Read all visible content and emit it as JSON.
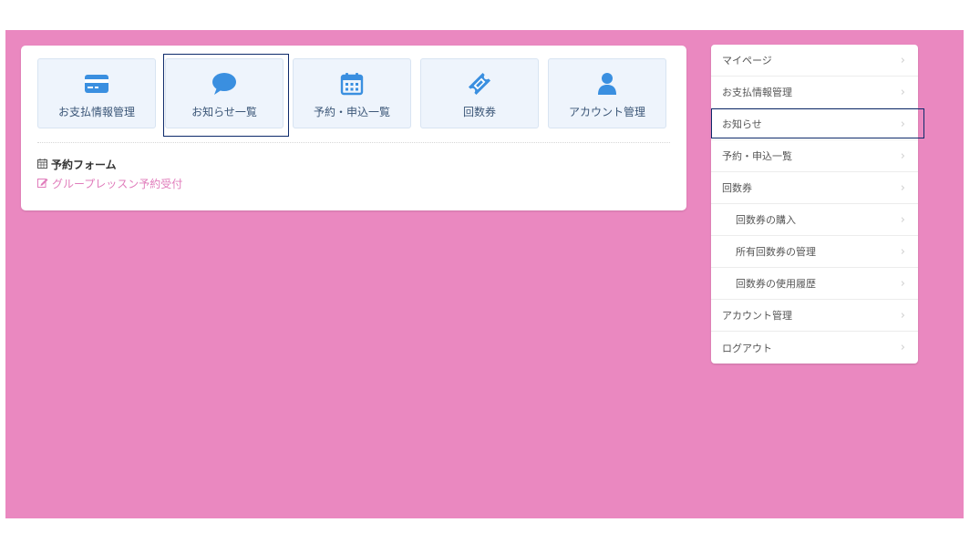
{
  "tiles": [
    {
      "label": "お支払情報管理",
      "icon": "credit-card-icon"
    },
    {
      "label": "お知らせ一覧",
      "icon": "speech-bubble-icon"
    },
    {
      "label": "予約・申込一覧",
      "icon": "calendar-icon"
    },
    {
      "label": "回数券",
      "icon": "ticket-icon"
    },
    {
      "label": "アカウント管理",
      "icon": "user-icon"
    }
  ],
  "selected_tile": "お知らせ一覧",
  "form": {
    "heading": "予約フォーム",
    "link": "グループレッスン予約受付"
  },
  "sidebar": {
    "items": [
      {
        "label": "マイページ"
      },
      {
        "label": "お支払情報管理"
      },
      {
        "label": "お知らせ"
      },
      {
        "label": "予約・申込一覧"
      },
      {
        "label": "回数券"
      },
      {
        "label": "回数券の購入"
      },
      {
        "label": "所有回数券の管理"
      },
      {
        "label": "回数券の使用履歴"
      },
      {
        "label": "アカウント管理"
      },
      {
        "label": "ログアウト"
      }
    ],
    "chevron": "›",
    "active": "お知らせ"
  },
  "colors": {
    "background": "#ea88c0",
    "tile_bg": "#eef4fc",
    "icon_blue": "#3a8fe0",
    "link_pink": "#e07cbb",
    "highlight_border": "#0d2a6b"
  }
}
